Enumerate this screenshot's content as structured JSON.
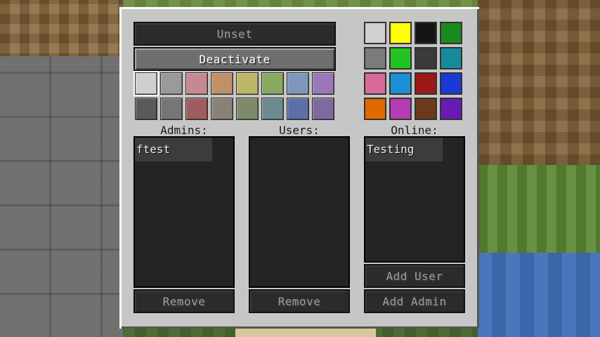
{
  "buttons": {
    "unset": "Unset",
    "deactivate": "Deactivate",
    "remove_admins": "Remove",
    "remove_users": "Remove",
    "add_user": "Add User",
    "add_admin": "Add Admin"
  },
  "labels": {
    "admins": "Admins:",
    "users": "Users:",
    "online": "Online:"
  },
  "lists": {
    "admins": [
      "ftest"
    ],
    "users": [],
    "online": [
      "Testing"
    ]
  },
  "texture_swatches": [
    "#cfcfcf",
    "#9a9a9a",
    "#c48a93",
    "#c0906a",
    "#bdb867",
    "#89a960",
    "#7f97b8",
    "#9a78b8",
    "#5a5a5a",
    "#767676",
    "#9e5d5f",
    "#8a8277",
    "#7e8a69",
    "#6c8a8f",
    "#5c6fa6",
    "#7f6a9e"
  ],
  "flat_swatches": [
    "#d0d0d0",
    "#ffff00",
    "#141414",
    "#1c8a1c",
    "#7b7b7b",
    "#22c422",
    "#3a3a3a",
    "#168a9a",
    "#d86a9a",
    "#1a8fd6",
    "#9a1a1a",
    "#1a3ad6",
    "#e06a00",
    "#b43cb4",
    "#6a3a1a",
    "#6a1ab4"
  ]
}
